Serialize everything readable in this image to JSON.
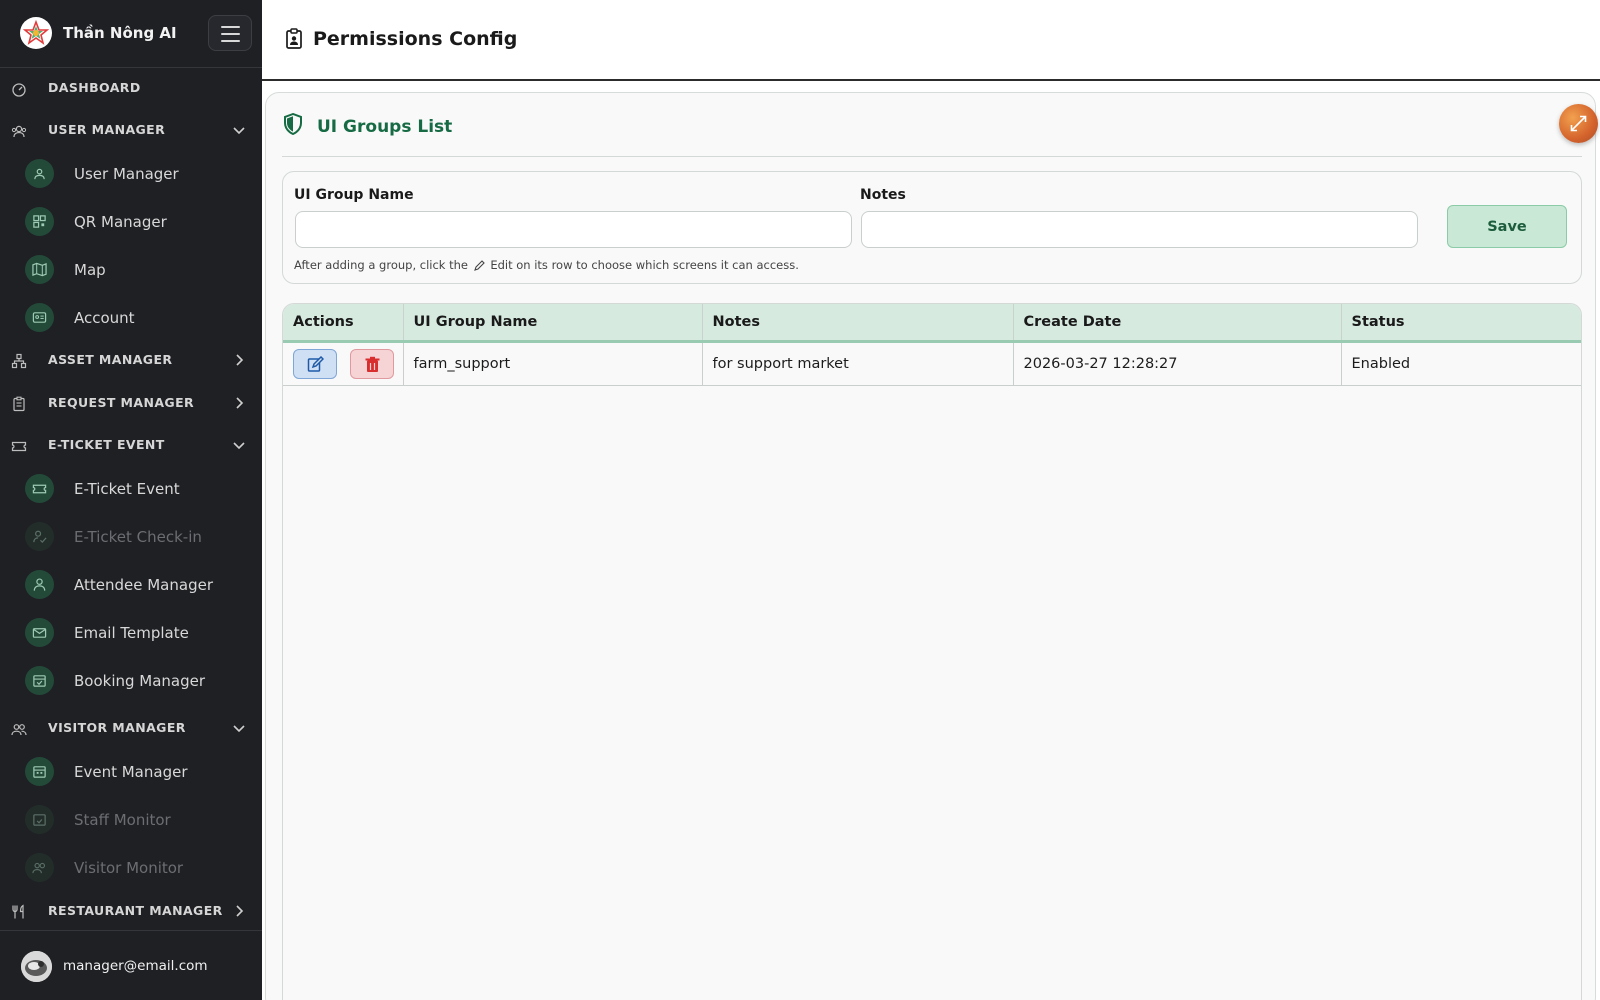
{
  "app": {
    "name": "Thần Nông AI"
  },
  "sidebar": {
    "sections": [
      {
        "label": "DASHBOARD",
        "icon": "dashboard-icon",
        "expanded": null,
        "items": []
      },
      {
        "label": "USER MANAGER",
        "icon": "users-icon",
        "expanded": true,
        "items": [
          {
            "label": "User Manager",
            "icon": "users-icon",
            "dim": false
          },
          {
            "label": "QR Manager",
            "icon": "qr-icon",
            "dim": false
          },
          {
            "label": "Map",
            "icon": "map-icon",
            "dim": false
          },
          {
            "label": "Account",
            "icon": "id-card-icon",
            "dim": false
          }
        ]
      },
      {
        "label": "ASSET MANAGER",
        "icon": "hierarchy-icon",
        "expanded": false,
        "items": []
      },
      {
        "label": "REQUEST MANAGER",
        "icon": "clipboard-icon",
        "expanded": false,
        "items": []
      },
      {
        "label": "E-TICKET EVENT",
        "icon": "ticket-icon",
        "expanded": true,
        "items": [
          {
            "label": "E-Ticket Event",
            "icon": "ticket-icon",
            "dim": false
          },
          {
            "label": "E-Ticket Check-in",
            "icon": "person-check-icon",
            "dim": true
          },
          {
            "label": "Attendee Manager",
            "icon": "person-icon",
            "dim": false
          },
          {
            "label": "Email Template",
            "icon": "envelope-icon",
            "dim": false
          },
          {
            "label": "Booking Manager",
            "icon": "calendar-check-icon",
            "dim": false
          }
        ]
      },
      {
        "label": "VISITOR MANAGER",
        "icon": "people-icon",
        "expanded": true,
        "items": [
          {
            "label": "Event Manager",
            "icon": "calendar-icon",
            "dim": false
          },
          {
            "label": "Staff Monitor",
            "icon": "calendar-check-icon",
            "dim": true
          },
          {
            "label": "Visitor Monitor",
            "icon": "people-icon",
            "dim": true
          }
        ]
      },
      {
        "label": "RESTAURANT MANAGER",
        "icon": "utensils-icon",
        "expanded": false,
        "items": []
      }
    ]
  },
  "user": {
    "email": "manager@email.com"
  },
  "header": {
    "title": "Permissions Config",
    "icon": "clipboard-person-icon"
  },
  "card": {
    "title": "UI Groups List",
    "icon": "shield-icon",
    "expand_icon": "expand-arrows-icon"
  },
  "form": {
    "group_name_label": "UI Group Name",
    "group_name_value": "",
    "notes_label": "Notes",
    "notes_value": "",
    "save_label": "Save",
    "hint_before": "After adding a group, click the",
    "hint_after": "Edit on its row to choose which screens it can access."
  },
  "table": {
    "columns": [
      "Actions",
      "UI Group Name",
      "Notes",
      "Create Date",
      "Status"
    ],
    "rows": [
      {
        "name": "farm_support",
        "notes": "for support market",
        "created": "2026-03-27 12:28:27",
        "status": "Enabled"
      }
    ]
  },
  "colors": {
    "sidebar_bg": "#1f2024",
    "accent": "#176b44",
    "header_row": "#d6eae0",
    "save_bg": "#c9e9d6"
  }
}
